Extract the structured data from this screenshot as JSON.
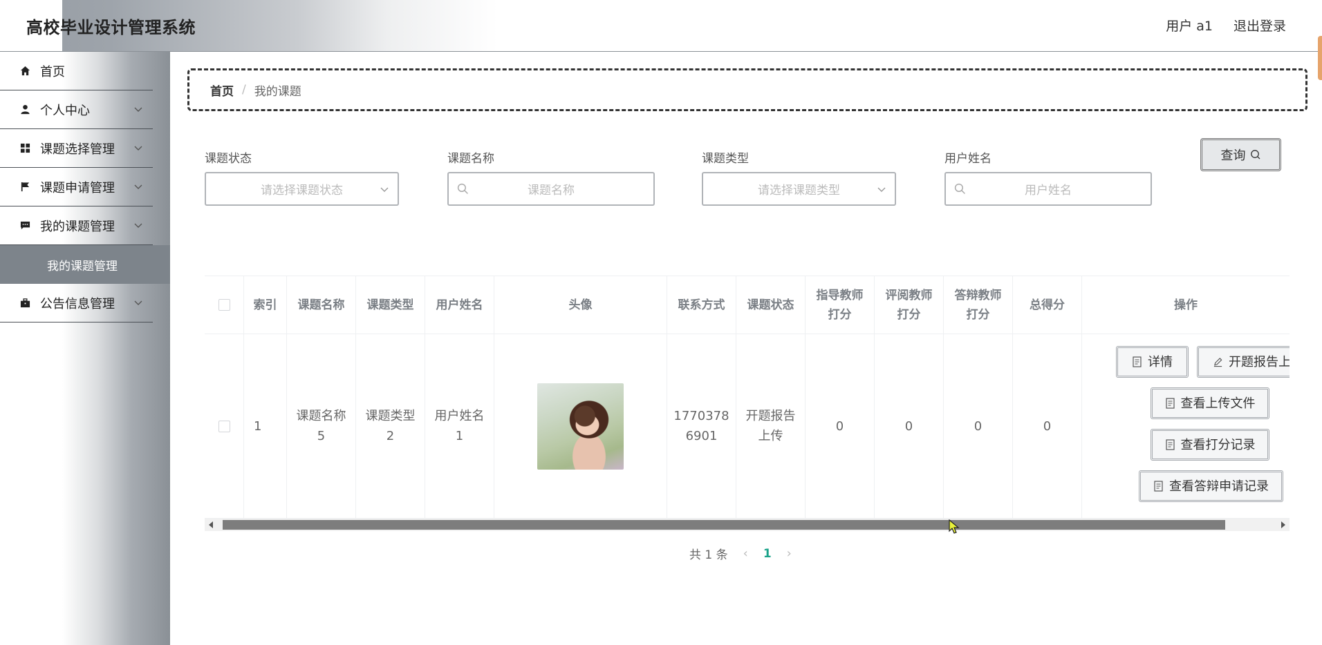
{
  "header": {
    "title": "高校毕业设计管理系统",
    "user_label": "用户 a1",
    "logout_label": "退出登录"
  },
  "sidebar": {
    "items": [
      {
        "label": "首页",
        "icon": "home-icon"
      },
      {
        "label": "个人中心",
        "icon": "user-icon"
      },
      {
        "label": "课题选择管理",
        "icon": "grid-icon"
      },
      {
        "label": "课题申请管理",
        "icon": "flag-icon"
      },
      {
        "label": "我的课题管理",
        "icon": "message-icon"
      },
      {
        "label": "公告信息管理",
        "icon": "briefcase-icon"
      }
    ],
    "active_sub": "我的课题管理"
  },
  "breadcrumb": {
    "home": "首页",
    "separator": "/",
    "current": "我的课题"
  },
  "filters": {
    "status": {
      "label": "课题状态",
      "placeholder": "请选择课题状态"
    },
    "name": {
      "label": "课题名称",
      "placeholder": "课题名称"
    },
    "type": {
      "label": "课题类型",
      "placeholder": "请选择课题类型"
    },
    "username": {
      "label": "用户姓名",
      "placeholder": "用户姓名"
    },
    "query_label": "查询"
  },
  "table": {
    "columns": [
      "索引",
      "课题名称",
      "课题类型",
      "用户姓名",
      "头像",
      "联系方式",
      "课题状态",
      "指导教师打分",
      "评阅教师打分",
      "答辩教师打分",
      "总得分",
      "操作"
    ],
    "column_display": {
      "advisor_score": [
        "指导教师",
        "打分"
      ],
      "reviewer_score": [
        "评阅教师",
        "打分"
      ],
      "defense_score": [
        "答辩教师",
        "打分"
      ]
    },
    "rows": [
      {
        "index": "1",
        "topic_name": [
          "课题名称",
          "5"
        ],
        "topic_type": [
          "课题类型",
          "2"
        ],
        "username": [
          "用户姓名",
          "1"
        ],
        "phone": [
          "1770378",
          "6901"
        ],
        "status": [
          "开题报告",
          "上传"
        ],
        "advisor_score": "0",
        "reviewer_score": "0",
        "defense_score": "0",
        "total": "0"
      }
    ],
    "actions": {
      "detail": "详情",
      "upload_report": "开题报告上传",
      "view_files": "查看上传文件",
      "view_scores": "查看打分记录",
      "view_defense": "查看答辩申请记录"
    }
  },
  "pagination": {
    "total_text": "共 1 条",
    "current_page": "1"
  }
}
